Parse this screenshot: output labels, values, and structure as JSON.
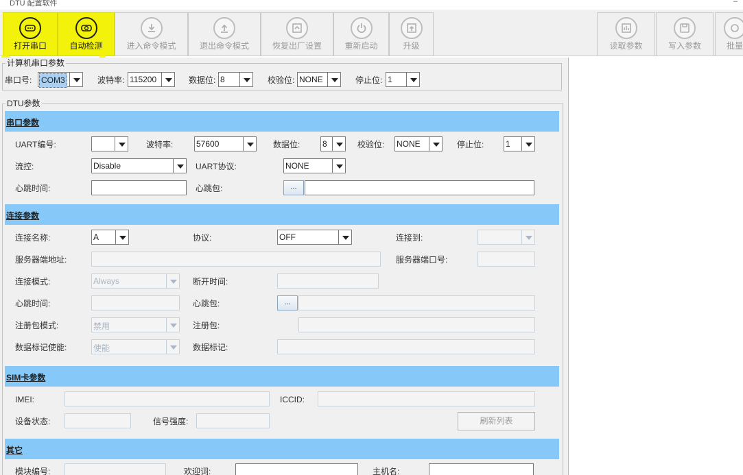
{
  "window": {
    "title": "DTU 配置软件",
    "min": "–"
  },
  "toolbar": {
    "buttons": [
      {
        "label": "打开串口",
        "icon": "serial-port-icon",
        "active": true
      },
      {
        "label": "自动检测",
        "icon": "auto-detect-icon",
        "active": true
      },
      {
        "label": "进入命令模式",
        "icon": "enter-cmd-icon",
        "active": false
      },
      {
        "label": "退出命令模式",
        "icon": "exit-cmd-icon",
        "active": false
      },
      {
        "label": "恢复出厂设置",
        "icon": "factory-reset-icon",
        "active": false
      },
      {
        "label": "重新启动",
        "icon": "power-icon",
        "active": false
      },
      {
        "label": "升级",
        "icon": "upgrade-icon",
        "active": false
      },
      {
        "label": "读取参数",
        "icon": "read-params-icon",
        "active": false
      },
      {
        "label": "写入参数",
        "icon": "save-icon",
        "active": false
      },
      {
        "label": "批量",
        "icon": "batch-icon",
        "active": false
      }
    ],
    "highlight_color": "#f2f20a"
  },
  "pc_serial": {
    "title": "计算机串口参数",
    "port_label": "串口号:",
    "port_value": "COM3",
    "baud_label": "波特率:",
    "baud_value": "115200",
    "data_label": "数据位:",
    "data_value": "8",
    "parity_label": "校验位:",
    "parity_value": "NONE",
    "stop_label": "停止位:",
    "stop_value": "1"
  },
  "dtu": {
    "title": "DTU参数",
    "serial": {
      "header": "串口参数",
      "uart_label": "UART编号:",
      "uart_value": "",
      "baud_label": "波特率:",
      "baud_value": "57600",
      "data_label": "数据位:",
      "data_value": "8",
      "parity_label": "校验位:",
      "parity_value": "NONE",
      "stop_label": "停止位:",
      "stop_value": "1",
      "flow_label": "流控:",
      "flow_value": "Disable",
      "proto_label": "UART协议:",
      "proto_value": "NONE",
      "hb_time_label": "心跳时间:",
      "hb_pkg_label": "心跳包:",
      "dots": "..."
    },
    "conn": {
      "header": "连接参数",
      "name_label": "连接名称:",
      "name_value": "A",
      "proto_label": "协议:",
      "proto_value": "OFF",
      "to_label": "连接到:",
      "server_addr_label": "服务器端地址:",
      "server_port_label": "服务器端口号:",
      "mode_label": "连接模式:",
      "mode_value": "Always",
      "disc_label": "断开时间:",
      "hb_time_label": "心跳时间:",
      "hb_pkg_label": "心跳包:",
      "dots": "...",
      "reg_mode_label": "注册包模式:",
      "reg_mode_value": "禁用",
      "reg_pkg_label": "注册包:",
      "mark_en_label": "数据标记使能:",
      "mark_en_value": "使能",
      "mark_label": "数据标记:"
    },
    "sim": {
      "header": "SIM卡参数",
      "imei_label": "IMEI:",
      "iccid_label": "ICCID:",
      "state_label": "设备状态:",
      "signal_label": "信号强度:",
      "refresh_label": "刷新列表"
    },
    "other": {
      "header": "其它",
      "module_label": "模块编号:",
      "welcome_label": "欢迎词:",
      "host_label": "主机名:"
    }
  },
  "colors": {
    "band": "#86c8f7",
    "panel": "#f0f0f0",
    "highlight": "#f2f20a"
  }
}
